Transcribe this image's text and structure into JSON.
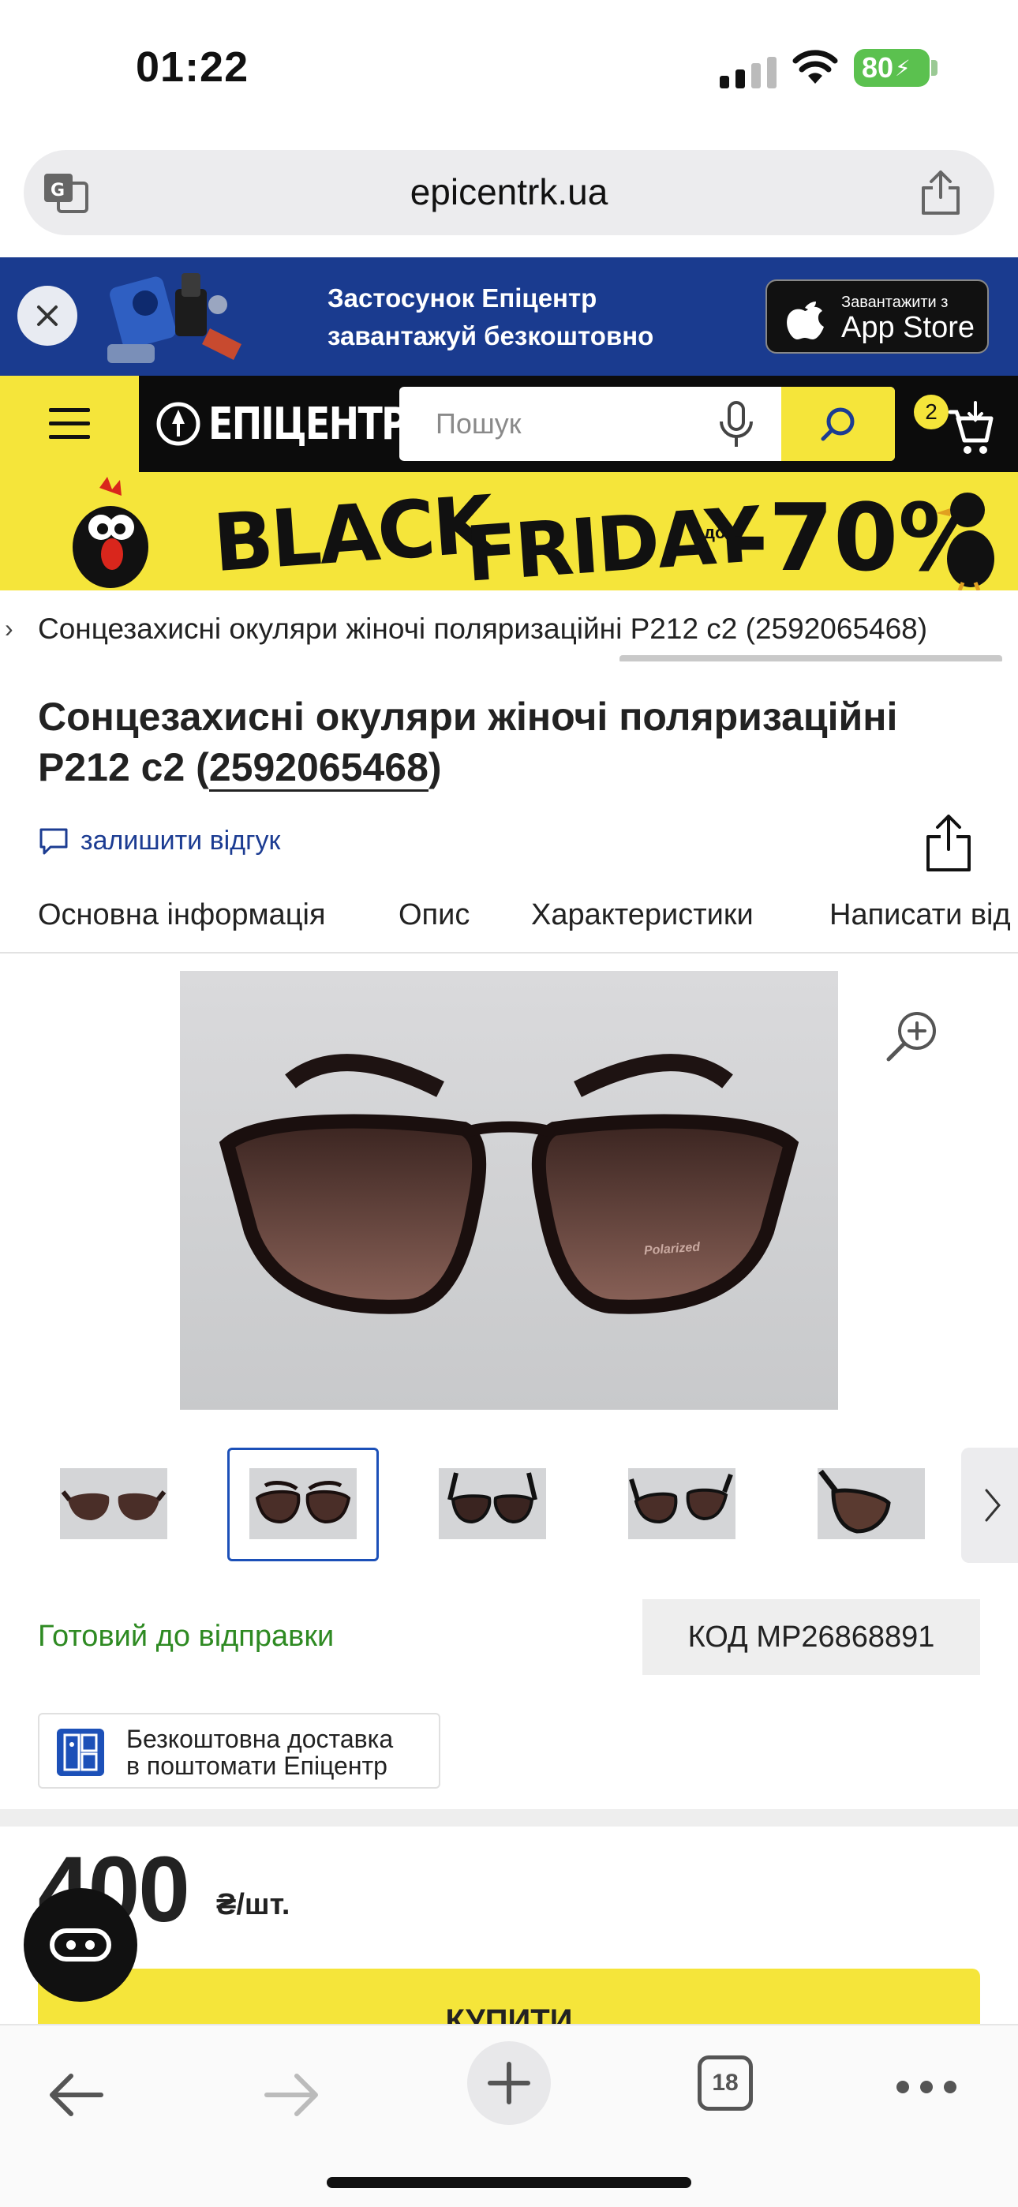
{
  "status_bar": {
    "time": "01:22",
    "battery": "80"
  },
  "browser": {
    "url": "epicentrk.ua",
    "tab_count": "18"
  },
  "app_banner": {
    "line1": "Застосунок Епіцентр",
    "line2": "завантажуй безкоштовно",
    "store_small": "Завантажити з",
    "store_big": "App Store"
  },
  "header": {
    "logo": "ЕПІЦЕНТР",
    "search_placeholder": "Пошук",
    "cart_count": "2"
  },
  "promo": {
    "word1": "BLACK",
    "word2": "FRIDAY",
    "prefix": "до",
    "percent": "-70%"
  },
  "breadcrumb": {
    "text": "Сонцезахисні окуляри жіночі поляризаційні P212 c2 (2592065468)"
  },
  "product": {
    "title_main": "Сонцезахисні окуляри жіночі поляризаційні P212 c2 (",
    "title_code": "2592065468",
    "title_end": ")",
    "review_link": "залишити відгук",
    "tabs": [
      "Основна інформація",
      "Опис",
      "Характеристики",
      "Написати від"
    ],
    "image_label": "Polarized",
    "thumbnail_count": 5,
    "selected_thumbnail": 2,
    "availability": "Готовий до відправки",
    "code": "КОД MP26868891",
    "delivery_line1": "Безкоштовна доставка",
    "delivery_line2": "в поштомати Епіцентр",
    "price": "400",
    "price_unit": "₴/шт.",
    "buy_label": "КУПИТИ"
  },
  "colors": {
    "brand_yellow": "#f5e53a",
    "brand_blue": "#1a3b8f",
    "link_blue": "#1c3c92",
    "ready_green": "#2e8a22"
  }
}
